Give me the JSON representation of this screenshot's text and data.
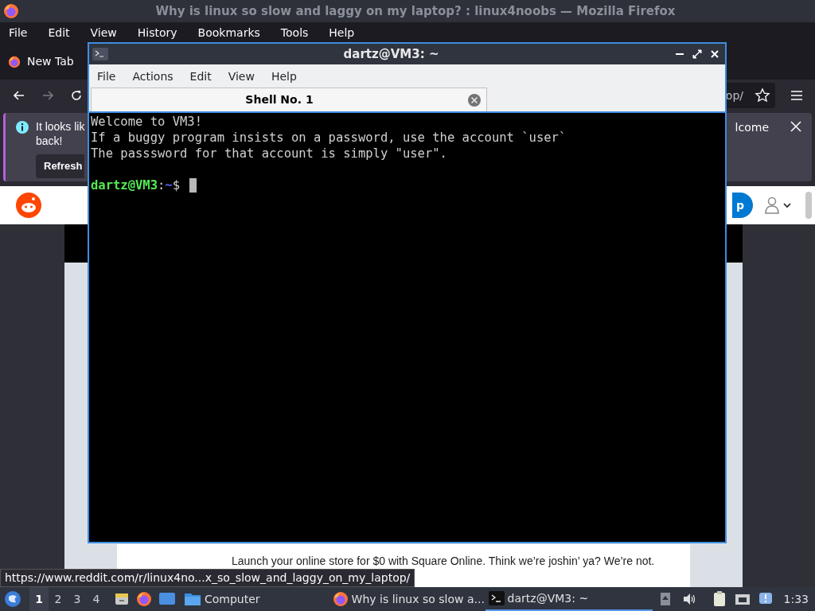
{
  "browser": {
    "title": "Why is linux so slow and laggy on my laptop? : linux4noobs — Mozilla Firefox",
    "menu": [
      "File",
      "Edit",
      "View",
      "History",
      "Bookmarks",
      "Tools",
      "Help"
    ],
    "tabs": [
      {
        "label": "New Tab",
        "selected": true
      }
    ],
    "url_tail": "op/",
    "notification": {
      "text_left": "It looks lik",
      "text_left_2": "back!",
      "text_right": "lcome",
      "button": "Refresh"
    },
    "signup_button": "p",
    "post": {
      "text": "Launch your online store for $0 with Square Online. Think we’re joshin’ ya? We’re not."
    },
    "status_url": "https://www.reddit.com/r/linux4no...x_so_slow_and_laggy_on_my_laptop/"
  },
  "terminal": {
    "title": "dartz@VM3: ~",
    "menu": [
      "File",
      "Actions",
      "Edit",
      "View",
      "Help"
    ],
    "tabs": [
      {
        "label": "Shell No. 1",
        "selected": true
      }
    ],
    "lines": [
      "Welcome to VM3!",
      "If a buggy program insists on a password, use the account `user`",
      "The passsword for that account is simply \"user\"."
    ],
    "prompt": {
      "user_host": "dartz@VM3",
      "sep": ":",
      "path": "~",
      "symbol": "$"
    }
  },
  "taskbar": {
    "workspaces": [
      {
        "label": "1",
        "selected": true
      },
      {
        "label": "2",
        "selected": false
      },
      {
        "label": "3",
        "selected": false
      },
      {
        "label": "4",
        "selected": false
      }
    ],
    "launchers": [
      {
        "kind": "files"
      },
      {
        "kind": "firefox"
      },
      {
        "kind": "desktop"
      },
      {
        "kind": "folder",
        "label": "Computer"
      }
    ],
    "tasks": [
      {
        "kind": "firefox",
        "label": "Why is linux so slow a...",
        "selected": false
      },
      {
        "kind": "terminal",
        "label": "dartz@VM3: ~",
        "selected": true
      }
    ],
    "clock": "1:33"
  }
}
